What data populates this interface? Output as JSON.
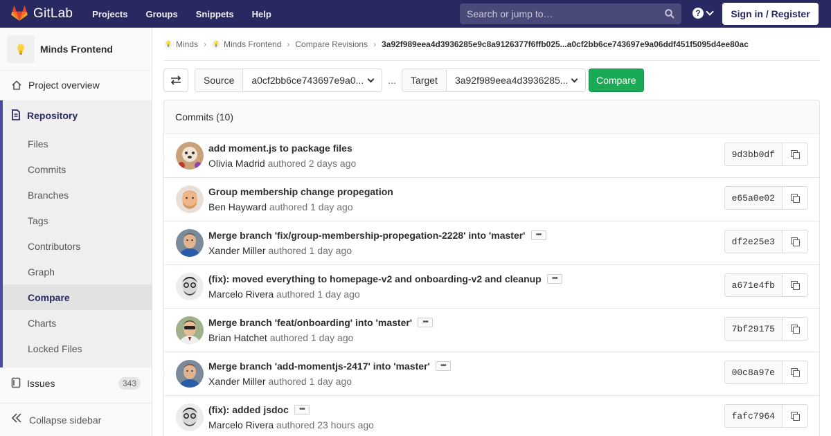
{
  "colors": {
    "navbar": "#292961",
    "accent": "#4b4ba3",
    "compare_button": "#1aaa55"
  },
  "header": {
    "brand": "GitLab",
    "nav": [
      "Projects",
      "Groups",
      "Snippets",
      "Help"
    ],
    "search_placeholder": "Search or jump to…",
    "help_label": "?",
    "signin_label": "Sign in / Register"
  },
  "sidebar": {
    "project_name": "Minds Frontend",
    "overview_label": "Project overview",
    "repository_label": "Repository",
    "repository_items": [
      {
        "label": "Files"
      },
      {
        "label": "Commits"
      },
      {
        "label": "Branches"
      },
      {
        "label": "Tags"
      },
      {
        "label": "Contributors"
      },
      {
        "label": "Graph"
      },
      {
        "label": "Compare"
      },
      {
        "label": "Charts"
      },
      {
        "label": "Locked Files"
      }
    ],
    "issues_label": "Issues",
    "issues_count": "343",
    "collapse_label": "Collapse sidebar"
  },
  "breadcrumb": {
    "items": [
      "Minds",
      "Minds Frontend",
      "Compare Revisions"
    ],
    "current": "3a92f989eea4d3936285e9c8a9126377f6ffb025...a0cf2bb6ce743697e9a06ddf451f5095d4ee80ac"
  },
  "compare": {
    "source_label": "Source",
    "source_value": "a0cf2bb6ce743697e9a0...",
    "separator": "...",
    "target_label": "Target",
    "target_value": "3a92f989eea4d3936285...",
    "button_label": "Compare"
  },
  "commits": {
    "header": "Commits (10)",
    "rows": [
      {
        "title": "add moment.js to package files",
        "author": "Olivia Madrid",
        "verb": "authored",
        "time": "2 days ago",
        "sha": "9d3bb0df",
        "more": false
      },
      {
        "title": "Group membership change propegation",
        "author": "Ben Hayward",
        "verb": "authored",
        "time": "1 day ago",
        "sha": "e65a0e02",
        "more": false
      },
      {
        "title": "Merge branch 'fix/group-membership-propegation-2228' into 'master'",
        "author": "Xander Miller",
        "verb": "authored",
        "time": "1 day ago",
        "sha": "df2e25e3",
        "more": true
      },
      {
        "title": "(fix): moved everything to homepage-v2 and onboarding-v2 and cleanup",
        "author": "Marcelo Rivera",
        "verb": "authored",
        "time": "1 day ago",
        "sha": "a671e4fb",
        "more": true
      },
      {
        "title": "Merge branch 'feat/onboarding' into 'master'",
        "author": "Brian Hatchet",
        "verb": "authored",
        "time": "1 day ago",
        "sha": "7bf29175",
        "more": true
      },
      {
        "title": "Merge branch 'add-momentjs-2417' into 'master'",
        "author": "Xander Miller",
        "verb": "authored",
        "time": "1 day ago",
        "sha": "00c8a97e",
        "more": true
      },
      {
        "title": "(fix): added jsdoc",
        "author": "Marcelo Rivera",
        "verb": "authored",
        "time": "23 hours ago",
        "sha": "fafc7964",
        "more": true
      }
    ]
  }
}
